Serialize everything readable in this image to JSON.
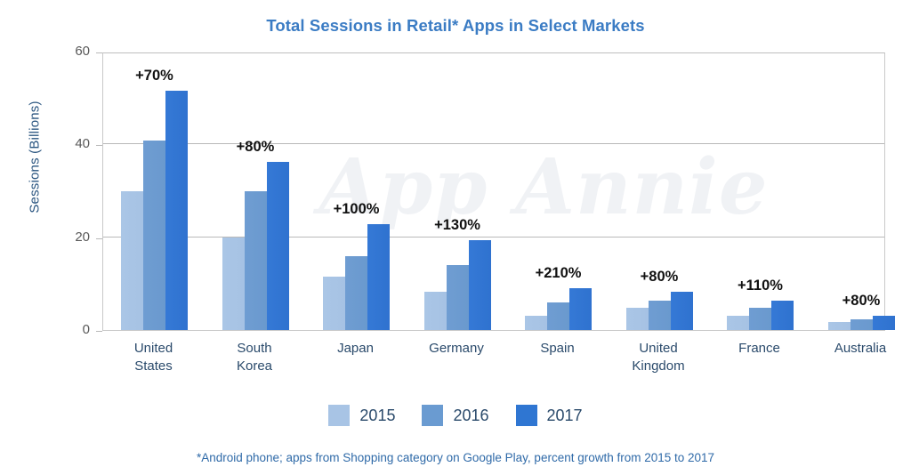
{
  "chart_data": {
    "type": "bar",
    "title": "Total Sessions in Retail* Apps in Select Markets",
    "xlabel": "",
    "ylabel": "Sessions (Billions)",
    "ylim": [
      0,
      60
    ],
    "yticks": [
      0,
      20,
      40,
      60
    ],
    "grid": true,
    "legend_position": "bottom",
    "categories": [
      "United States",
      "South Korea",
      "Japan",
      "Germany",
      "Spain",
      "United Kingdom",
      "France",
      "Australia"
    ],
    "category_lines": [
      [
        "United",
        "States"
      ],
      [
        "South",
        "Korea"
      ],
      [
        "Japan"
      ],
      [
        "Germany"
      ],
      [
        "Spain"
      ],
      [
        "United",
        "Kingdom"
      ],
      [
        "France"
      ],
      [
        "Australia"
      ]
    ],
    "series": [
      {
        "name": "2015",
        "color": "#a8c4e5",
        "values": [
          30.0,
          20.0,
          11.5,
          8.3,
          3.0,
          4.7,
          3.0,
          1.7
        ]
      },
      {
        "name": "2016",
        "color": "#6a9bd1",
        "values": [
          40.8,
          30.0,
          16.0,
          14.0,
          6.0,
          6.3,
          4.8,
          2.3
        ]
      },
      {
        "name": "2017",
        "color": "#2f76d2",
        "values": [
          51.5,
          36.2,
          22.8,
          19.3,
          9.0,
          8.2,
          6.3,
          3.1
        ]
      }
    ],
    "annotations": [
      {
        "category": "United States",
        "text": "+70%"
      },
      {
        "category": "South Korea",
        "text": "+80%"
      },
      {
        "category": "Japan",
        "text": "+100%"
      },
      {
        "category": "Germany",
        "text": "+130%"
      },
      {
        "category": "Spain",
        "text": "+210%"
      },
      {
        "category": "United Kingdom",
        "text": "+80%"
      },
      {
        "category": "France",
        "text": "+110%"
      },
      {
        "category": "Australia",
        "text": "+80%"
      }
    ],
    "watermark": "App Annie",
    "footnote": "*Android phone; apps from Shopping category on Google Play, percent growth from 2015 to 2017"
  },
  "colors": {
    "title": "#3b7cc4",
    "axis_text": "#2a4a6b",
    "tick_text": "#595959",
    "footnote": "#2f6aa8",
    "grid": "#b9b9b9",
    "series_2015": "#a8c4e5",
    "series_2016": "#6a9bd1",
    "series_2017": "#2f76d2"
  }
}
